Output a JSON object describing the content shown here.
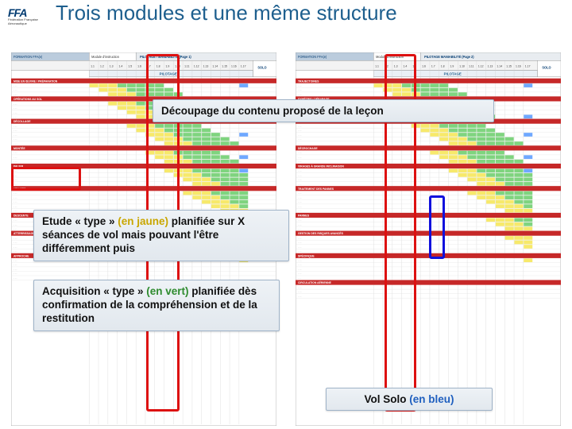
{
  "logo": {
    "abbr": "FFA",
    "sub": "Fédération Française Aéronautique"
  },
  "title": "Trois modules et une même structure",
  "callouts": {
    "decoupage": "Découpage du contenu proposé de la leçon",
    "etude_pre": "Etude « type » ",
    "etude_hl": "(en jaune)",
    "etude_post": " planifiée sur X séances de vol mais pouvant l'être différemment puis",
    "acq_pre": "Acquisition « type » ",
    "acq_hl": "(en vert)",
    "acq_post": " planifiée dès confirmation de la compréhension et de la restitution",
    "solo_pre": "Vol Solo ",
    "solo_hl": "(en bleu)"
  },
  "tables": {
    "left": {
      "header_title": "FORMATION FFA(e)",
      "module": "Module d'instruction",
      "phase": "PILOTAGE / MANIABILITÉ (Page 1)",
      "col_headers": [
        "1.1",
        "1.2",
        "1.3",
        "1.4",
        "1.5",
        "1.6",
        "1.7",
        "1.8",
        "1.9",
        "1.10",
        "1.11",
        "1.12",
        "1.13",
        "1.14",
        "1.15",
        "1.16",
        "1.17"
      ],
      "solo_label": "SOLO",
      "page_label": "PILOTAGE",
      "sections": [
        "MISE EN ŒUVRE / PRÉPARATION",
        "OPÉRATIONS AU SOL",
        "DÉCOLLAGE",
        "MONTÉE",
        "PALIER",
        "VIRAGES",
        "DESCENTE",
        "ATTERRISSAGE",
        "APPROCHE"
      ]
    },
    "right": {
      "header_title": "FORMATION FFA(e)",
      "module": "Module d'instruction",
      "phase": "PILOTAGE MANIABILITÉ (Page 2)",
      "col_headers": [
        "1.1",
        "1.2",
        "1.3",
        "1.4",
        "1.5",
        "1.6",
        "1.7",
        "1.8",
        "1.9",
        "1.10",
        "1.11",
        "1.12",
        "1.13",
        "1.14",
        "1.15",
        "1.16",
        "1.17"
      ],
      "solo_label": "SOLO",
      "page_label": "PILOTAGE",
      "sections": [
        "TRAJECTOIRES",
        "SYMÉTRIE / DÉRAPAGE",
        "VOL LENT",
        "DÉCROCHAGE",
        "VIRAGES À GRANDE INCLINAISON",
        "TRAITEMENT DES PANNES",
        "PANNES",
        "GESTION DES RISQUES AVANCÉS",
        "SPÉCIFIQUE",
        "CIRCULATION AÉRIENNE"
      ]
    }
  }
}
